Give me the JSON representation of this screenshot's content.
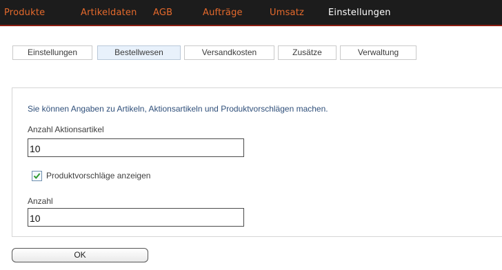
{
  "nav": {
    "items": [
      {
        "label": "Produkte"
      },
      {
        "label": "Artikeldaten"
      },
      {
        "label": "AGB"
      },
      {
        "label": "Aufträge"
      },
      {
        "label": "Umsatz"
      },
      {
        "label": "Einstellungen"
      }
    ],
    "active_index": 5,
    "colors": {
      "background": "#1c1c1c",
      "item": "#e66a2c",
      "active": "#ffffff",
      "underline": "#8b1d12"
    }
  },
  "tabs": {
    "items": [
      {
        "label": "Einstellungen"
      },
      {
        "label": "Bestellwesen"
      },
      {
        "label": "Versandkosten"
      },
      {
        "label": "Zusätze"
      },
      {
        "label": "Verwaltung"
      }
    ],
    "active_index": 1
  },
  "form": {
    "intro": "Sie können Angaben zu Artikeln, Aktionsartikeln und Produktvorschlägen machen.",
    "aktionsartikel_label": "Anzahl Aktionsartikel",
    "aktionsartikel_value": "10",
    "vorschlaege_label": "Produktvorschläge anzeigen",
    "vorschlaege_checked": true,
    "anzahl_label": "Anzahl",
    "anzahl_value": "10",
    "ok_label": "OK"
  }
}
